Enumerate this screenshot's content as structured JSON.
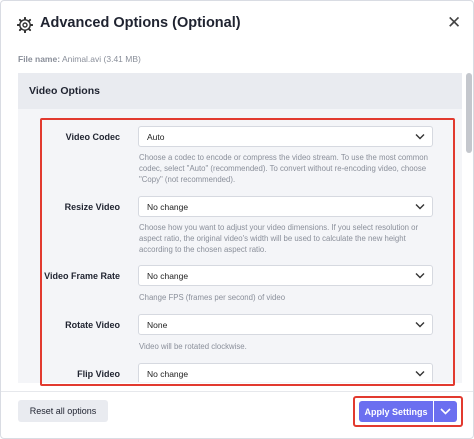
{
  "dialog": {
    "title": "Advanced Options (Optional)",
    "close_icon": "close-icon",
    "settings_icon": "gear-icon"
  },
  "file": {
    "label": "File name:",
    "value": "Animal.avi (3.41 MB)"
  },
  "section": {
    "title": "Video Options"
  },
  "options": [
    {
      "label": "Video Codec",
      "value": "Auto",
      "help": "Choose a codec to encode or compress the video stream. To use the most common codec, select \"Auto\" (recommended). To convert without re-encoding video, choose \"Copy\" (not recommended)."
    },
    {
      "label": "Resize Video",
      "value": "No change",
      "help": "Choose how you want to adjust your video dimensions. If you select resolution or aspect ratio, the original video's width will be used to calculate the new height according to the chosen aspect ratio."
    },
    {
      "label": "Video Frame Rate",
      "value": "No change",
      "help": "Change FPS (frames per second) of video"
    },
    {
      "label": "Rotate Video",
      "value": "None",
      "help": "Video will be rotated clockwise."
    },
    {
      "label": "Flip Video",
      "value": "No change",
      "help": ""
    }
  ],
  "footer": {
    "reset_label": "Reset all options",
    "apply_label": "Apply Settings"
  },
  "colors": {
    "accent": "#6b6ff0",
    "highlight": "#e23a2f"
  }
}
